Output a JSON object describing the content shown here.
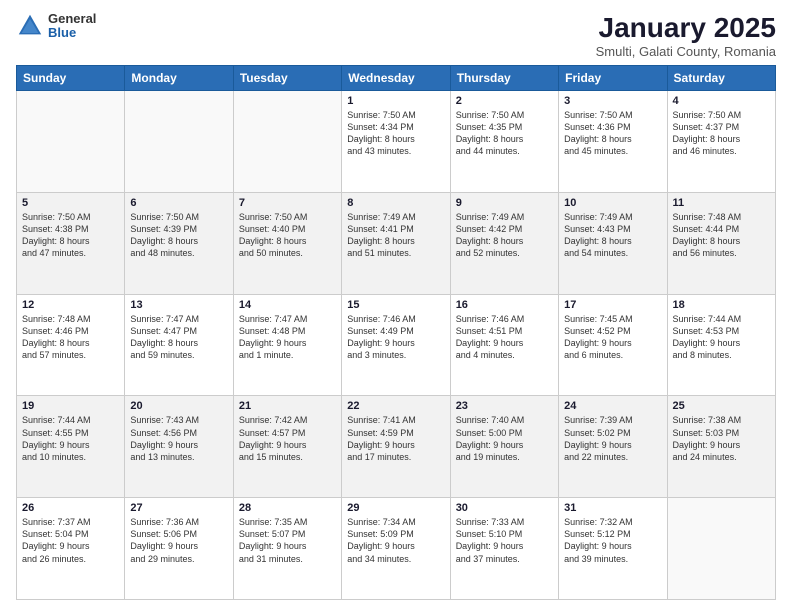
{
  "header": {
    "logo_general": "General",
    "logo_blue": "Blue",
    "title": "January 2025",
    "subtitle": "Smulti, Galati County, Romania"
  },
  "calendar": {
    "days_of_week": [
      "Sunday",
      "Monday",
      "Tuesday",
      "Wednesday",
      "Thursday",
      "Friday",
      "Saturday"
    ],
    "weeks": [
      [
        {
          "day": "",
          "info": ""
        },
        {
          "day": "",
          "info": ""
        },
        {
          "day": "",
          "info": ""
        },
        {
          "day": "1",
          "info": "Sunrise: 7:50 AM\nSunset: 4:34 PM\nDaylight: 8 hours\nand 43 minutes."
        },
        {
          "day": "2",
          "info": "Sunrise: 7:50 AM\nSunset: 4:35 PM\nDaylight: 8 hours\nand 44 minutes."
        },
        {
          "day": "3",
          "info": "Sunrise: 7:50 AM\nSunset: 4:36 PM\nDaylight: 8 hours\nand 45 minutes."
        },
        {
          "day": "4",
          "info": "Sunrise: 7:50 AM\nSunset: 4:37 PM\nDaylight: 8 hours\nand 46 minutes."
        }
      ],
      [
        {
          "day": "5",
          "info": "Sunrise: 7:50 AM\nSunset: 4:38 PM\nDaylight: 8 hours\nand 47 minutes."
        },
        {
          "day": "6",
          "info": "Sunrise: 7:50 AM\nSunset: 4:39 PM\nDaylight: 8 hours\nand 48 minutes."
        },
        {
          "day": "7",
          "info": "Sunrise: 7:50 AM\nSunset: 4:40 PM\nDaylight: 8 hours\nand 50 minutes."
        },
        {
          "day": "8",
          "info": "Sunrise: 7:49 AM\nSunset: 4:41 PM\nDaylight: 8 hours\nand 51 minutes."
        },
        {
          "day": "9",
          "info": "Sunrise: 7:49 AM\nSunset: 4:42 PM\nDaylight: 8 hours\nand 52 minutes."
        },
        {
          "day": "10",
          "info": "Sunrise: 7:49 AM\nSunset: 4:43 PM\nDaylight: 8 hours\nand 54 minutes."
        },
        {
          "day": "11",
          "info": "Sunrise: 7:48 AM\nSunset: 4:44 PM\nDaylight: 8 hours\nand 56 minutes."
        }
      ],
      [
        {
          "day": "12",
          "info": "Sunrise: 7:48 AM\nSunset: 4:46 PM\nDaylight: 8 hours\nand 57 minutes."
        },
        {
          "day": "13",
          "info": "Sunrise: 7:47 AM\nSunset: 4:47 PM\nDaylight: 8 hours\nand 59 minutes."
        },
        {
          "day": "14",
          "info": "Sunrise: 7:47 AM\nSunset: 4:48 PM\nDaylight: 9 hours\nand 1 minute."
        },
        {
          "day": "15",
          "info": "Sunrise: 7:46 AM\nSunset: 4:49 PM\nDaylight: 9 hours\nand 3 minutes."
        },
        {
          "day": "16",
          "info": "Sunrise: 7:46 AM\nSunset: 4:51 PM\nDaylight: 9 hours\nand 4 minutes."
        },
        {
          "day": "17",
          "info": "Sunrise: 7:45 AM\nSunset: 4:52 PM\nDaylight: 9 hours\nand 6 minutes."
        },
        {
          "day": "18",
          "info": "Sunrise: 7:44 AM\nSunset: 4:53 PM\nDaylight: 9 hours\nand 8 minutes."
        }
      ],
      [
        {
          "day": "19",
          "info": "Sunrise: 7:44 AM\nSunset: 4:55 PM\nDaylight: 9 hours\nand 10 minutes."
        },
        {
          "day": "20",
          "info": "Sunrise: 7:43 AM\nSunset: 4:56 PM\nDaylight: 9 hours\nand 13 minutes."
        },
        {
          "day": "21",
          "info": "Sunrise: 7:42 AM\nSunset: 4:57 PM\nDaylight: 9 hours\nand 15 minutes."
        },
        {
          "day": "22",
          "info": "Sunrise: 7:41 AM\nSunset: 4:59 PM\nDaylight: 9 hours\nand 17 minutes."
        },
        {
          "day": "23",
          "info": "Sunrise: 7:40 AM\nSunset: 5:00 PM\nDaylight: 9 hours\nand 19 minutes."
        },
        {
          "day": "24",
          "info": "Sunrise: 7:39 AM\nSunset: 5:02 PM\nDaylight: 9 hours\nand 22 minutes."
        },
        {
          "day": "25",
          "info": "Sunrise: 7:38 AM\nSunset: 5:03 PM\nDaylight: 9 hours\nand 24 minutes."
        }
      ],
      [
        {
          "day": "26",
          "info": "Sunrise: 7:37 AM\nSunset: 5:04 PM\nDaylight: 9 hours\nand 26 minutes."
        },
        {
          "day": "27",
          "info": "Sunrise: 7:36 AM\nSunset: 5:06 PM\nDaylight: 9 hours\nand 29 minutes."
        },
        {
          "day": "28",
          "info": "Sunrise: 7:35 AM\nSunset: 5:07 PM\nDaylight: 9 hours\nand 31 minutes."
        },
        {
          "day": "29",
          "info": "Sunrise: 7:34 AM\nSunset: 5:09 PM\nDaylight: 9 hours\nand 34 minutes."
        },
        {
          "day": "30",
          "info": "Sunrise: 7:33 AM\nSunset: 5:10 PM\nDaylight: 9 hours\nand 37 minutes."
        },
        {
          "day": "31",
          "info": "Sunrise: 7:32 AM\nSunset: 5:12 PM\nDaylight: 9 hours\nand 39 minutes."
        },
        {
          "day": "",
          "info": ""
        }
      ]
    ]
  }
}
